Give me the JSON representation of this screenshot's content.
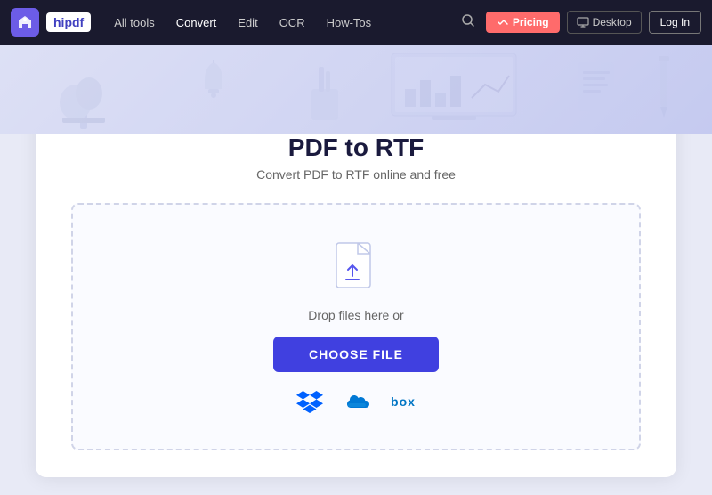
{
  "brand": {
    "wondershare_alt": "Wondershare",
    "hipdf_label": "hipdf"
  },
  "navbar": {
    "links": [
      {
        "label": "All tools",
        "active": false
      },
      {
        "label": "Convert",
        "active": true
      },
      {
        "label": "Edit",
        "active": false
      },
      {
        "label": "OCR",
        "active": false
      },
      {
        "label": "How-Tos",
        "active": false
      }
    ],
    "pricing_label": "Pricing",
    "desktop_label": "Desktop",
    "login_label": "Log In"
  },
  "page": {
    "title": "PDF to RTF",
    "subtitle": "Convert PDF to RTF online and free",
    "drop_text": "Drop files here or",
    "choose_file_label": "CHOOSE FILE"
  },
  "cloud": {
    "dropbox_label": "Dropbox",
    "onedrive_label": "OneDrive",
    "box_label": "box"
  }
}
